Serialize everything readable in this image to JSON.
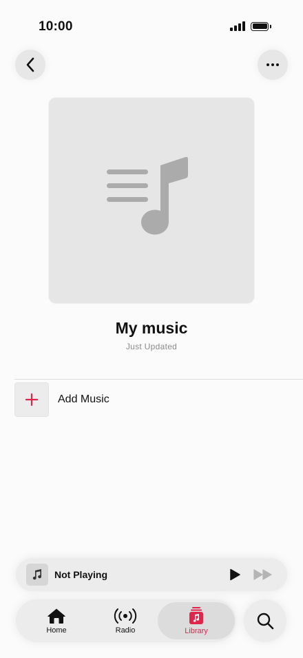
{
  "status_bar": {
    "time": "10:00"
  },
  "nav": {
    "back_icon": "chevron-left-icon",
    "more_icon": "ellipsis-icon"
  },
  "playlist": {
    "artwork_icon": "playlist-music-note-icon",
    "title": "My music",
    "subtitle": "Just Updated"
  },
  "actions": {
    "add_music_label": "Add Music",
    "add_icon": "plus-icon"
  },
  "mini_player": {
    "title": "Not Playing",
    "play_icon": "play-icon",
    "forward_icon": "fast-forward-icon"
  },
  "tab_bar": {
    "tabs": [
      {
        "label": "Home",
        "icon": "house-icon",
        "selected": false
      },
      {
        "label": "Radio",
        "icon": "radio-broadcast-icon",
        "selected": false
      },
      {
        "label": "Library",
        "icon": "library-stack-icon",
        "selected": true
      }
    ],
    "search_icon": "magnifying-glass-icon"
  },
  "colors": {
    "accent": "#e0254a",
    "background": "#fbfbfb",
    "artwork_bg": "#e6e6e6",
    "artwork_glyph": "#ababab",
    "secondary_text": "#8a8a8a"
  }
}
